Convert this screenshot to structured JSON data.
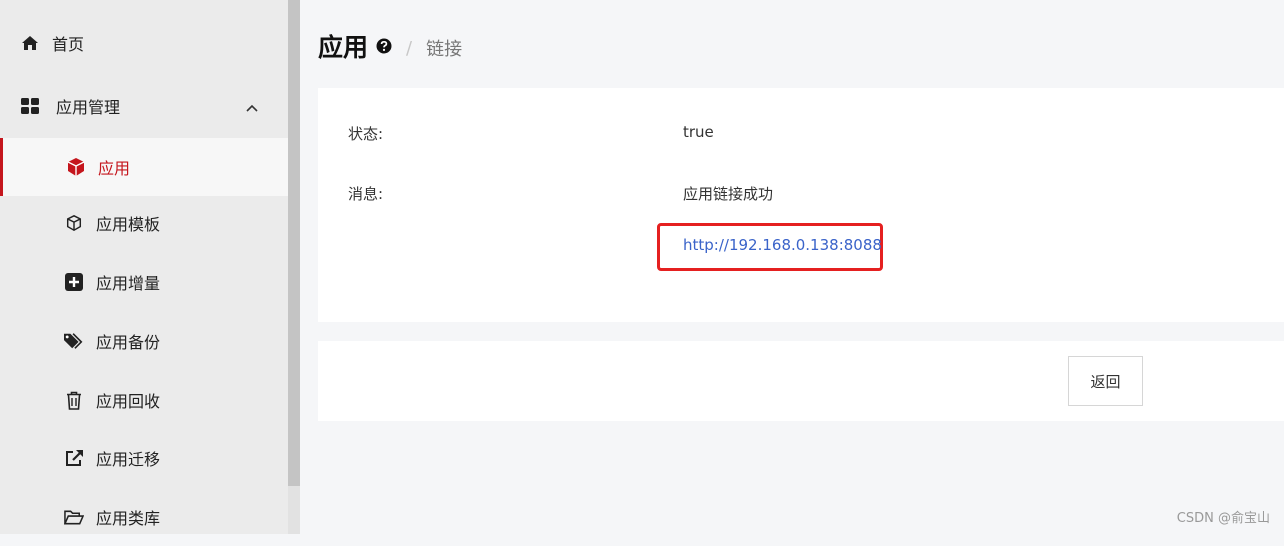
{
  "sidebar": {
    "home": {
      "label": "首页",
      "icon": "home-icon"
    },
    "group": {
      "label": "应用管理",
      "icon": "grid-icon",
      "expanded": true
    },
    "items": [
      {
        "label": "应用",
        "icon": "cube-icon",
        "active": true
      },
      {
        "label": "应用模板",
        "icon": "cube-outline-icon"
      },
      {
        "label": "应用增量",
        "icon": "plus-square-icon"
      },
      {
        "label": "应用备份",
        "icon": "tags-icon"
      },
      {
        "label": "应用回收",
        "icon": "trash-icon"
      },
      {
        "label": "应用迁移",
        "icon": "share-icon"
      },
      {
        "label": "应用类库",
        "icon": "folder-open-icon"
      }
    ]
  },
  "header": {
    "title": "应用",
    "separator": "/",
    "breadcrumb": "链接"
  },
  "result": {
    "status_label": "状态:",
    "status_value": "true",
    "message_label": "消息:",
    "message_value": "应用链接成功",
    "link": "http://192.168.0.138:8088"
  },
  "footer": {
    "back_label": "返回"
  },
  "watermark": "CSDN @俞宝山",
  "colors": {
    "accent": "#c5161d",
    "link": "#3a63c9",
    "highlight": "#e52020"
  }
}
